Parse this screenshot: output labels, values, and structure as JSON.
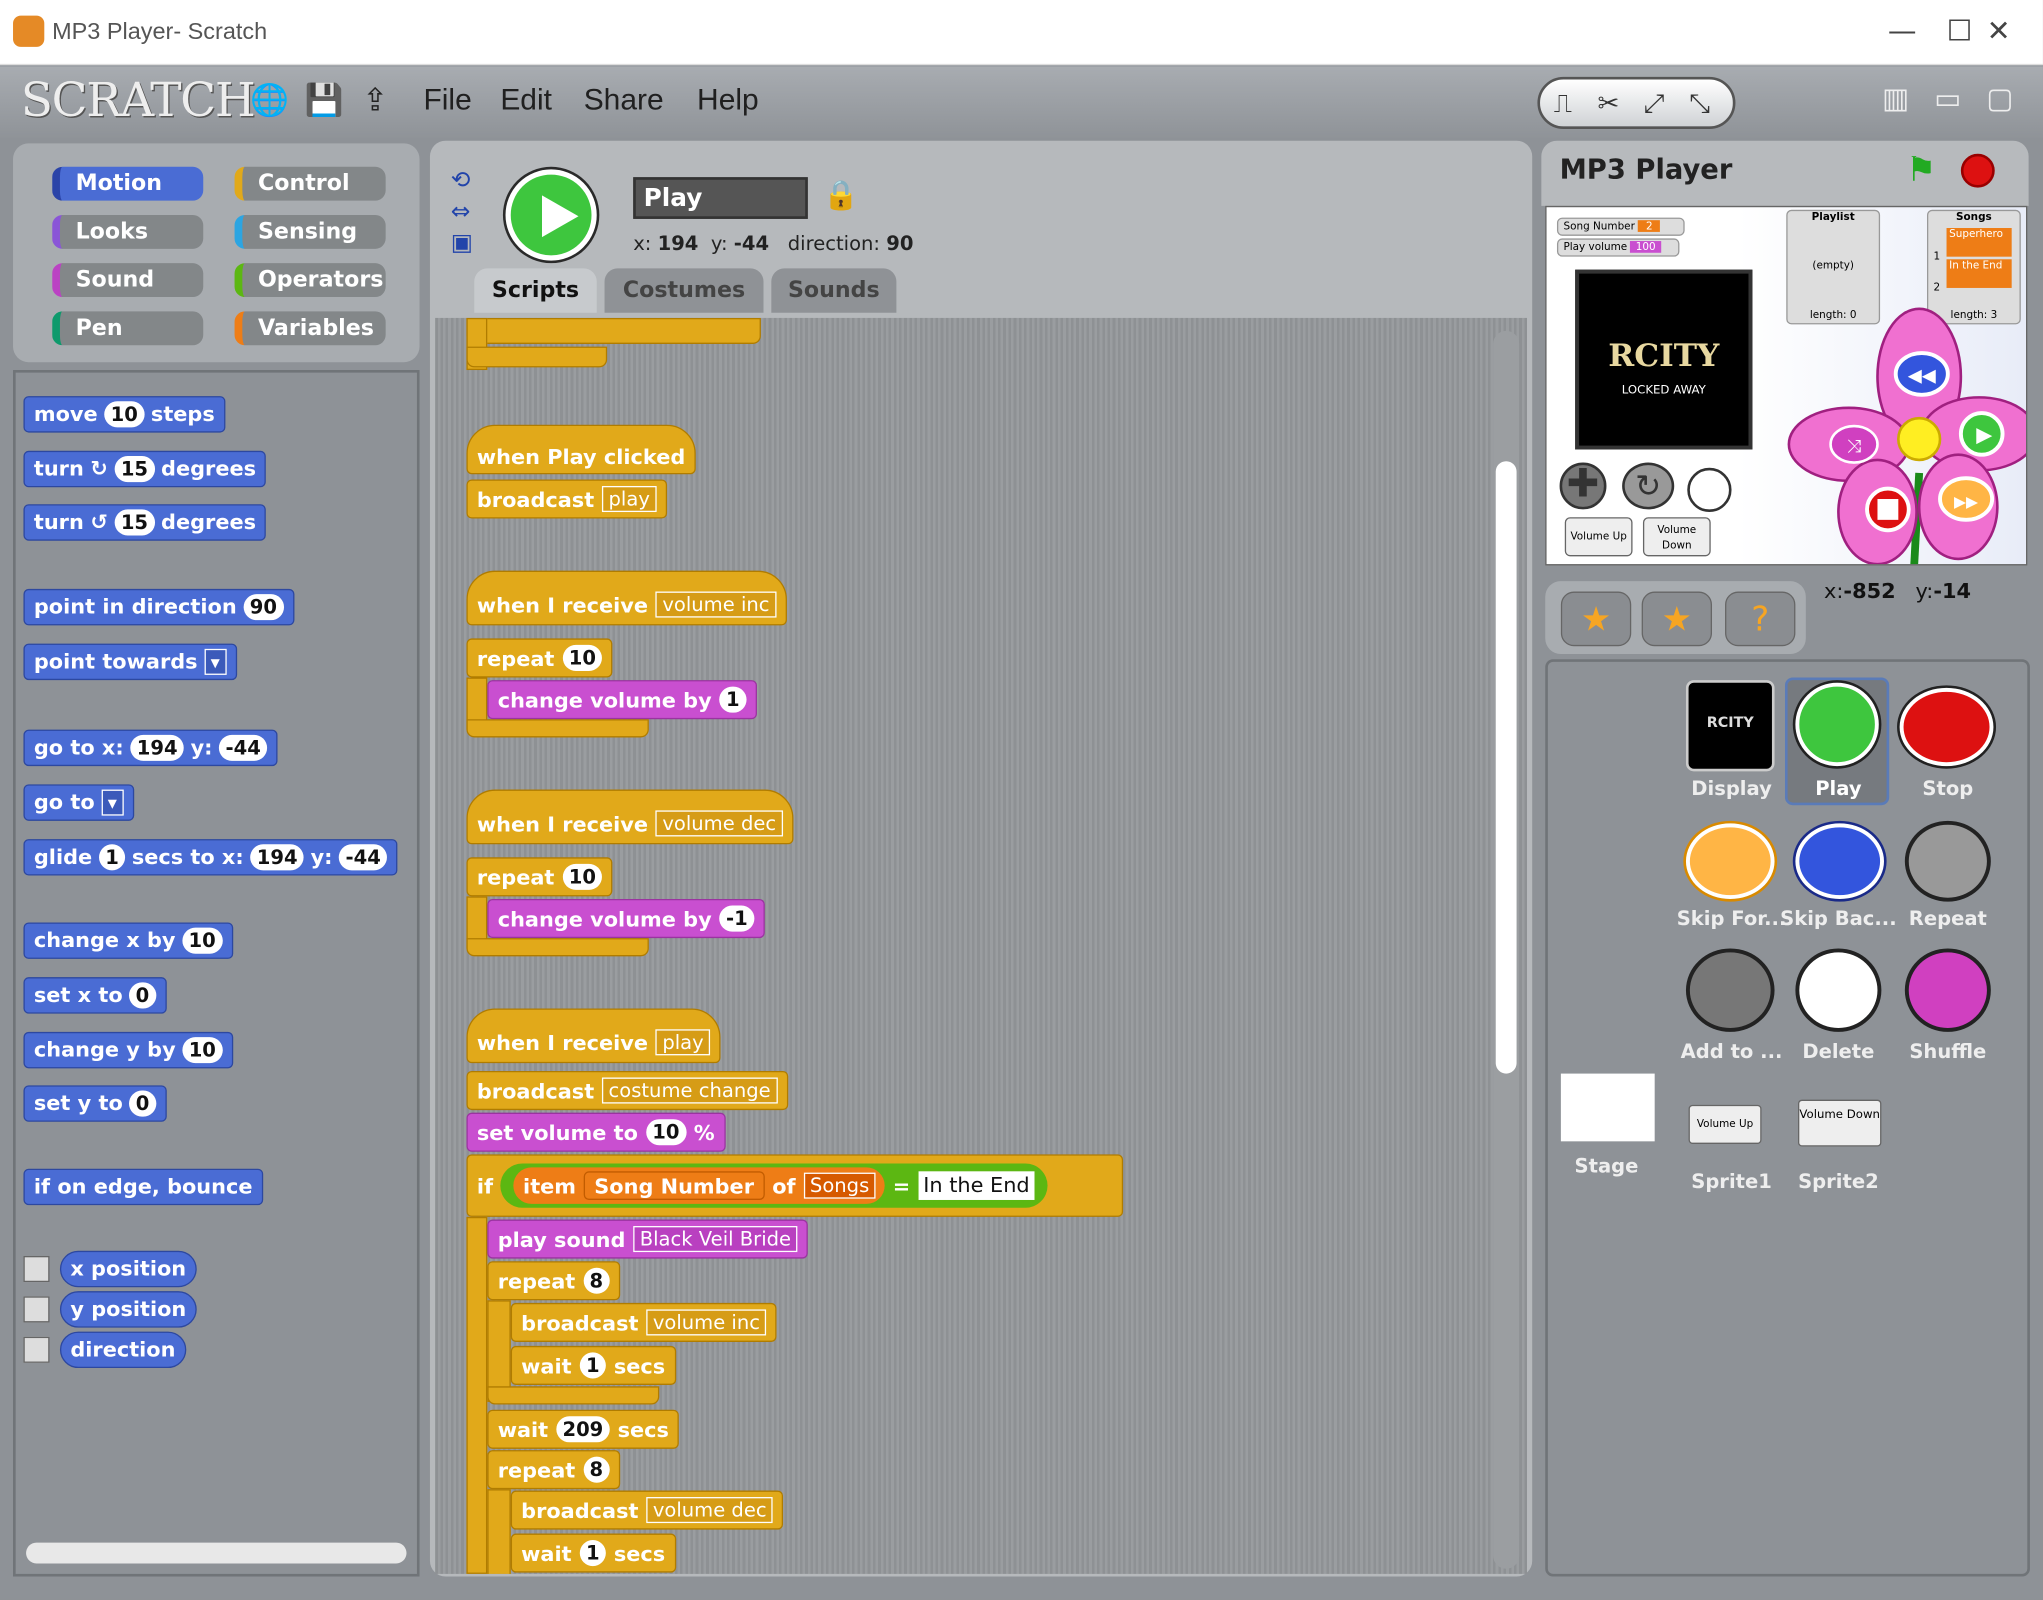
{
  "window": {
    "title": "MP3 Player- Scratch",
    "minimize_glyph": "—",
    "maximize_glyph": "☐",
    "close_glyph": "✕"
  },
  "logo": "SCRATCH",
  "menu": {
    "file": "File",
    "edit": "Edit",
    "share": "Share",
    "help": "Help"
  },
  "categories": {
    "motion": "Motion",
    "looks": "Looks",
    "sound": "Sound",
    "pen": "Pen",
    "control": "Control",
    "sensing": "Sensing",
    "operators": "Operators",
    "variables": "Variables"
  },
  "palette": {
    "move_a": "move",
    "move_n": "10",
    "move_b": "steps",
    "turn_cw_a": "turn",
    "turn_cw_n": "15",
    "turn_cw_b": "degrees",
    "turn_ccw_a": "turn",
    "turn_ccw_n": "15",
    "turn_ccw_b": "degrees",
    "point_dir_a": "point in direction",
    "point_dir_n": "90",
    "point_towards": "point towards",
    "goto_a": "go to x:",
    "goto_x": "194",
    "goto_b": "y:",
    "goto_y": "-44",
    "goto_sprite": "go to",
    "glide_a": "glide",
    "glide_n": "1",
    "glide_b": "secs to x:",
    "glide_x": "194",
    "glide_c": "y:",
    "glide_y": "-44",
    "change_x_a": "change x by",
    "change_x_n": "10",
    "set_x_a": "set x to",
    "set_x_n": "0",
    "change_y_a": "change y by",
    "change_y_n": "10",
    "set_y_a": "set y to",
    "set_y_n": "0",
    "bounce": "if on edge, bounce",
    "x_position": "x position",
    "y_position": "y position",
    "direction": "direction"
  },
  "sprite": {
    "name": "Play",
    "x_label": "x:",
    "x": "194",
    "y_label": "y:",
    "y": "-44",
    "direction_label": "direction:",
    "direction": "90"
  },
  "tabs": {
    "scripts": "Scripts",
    "costumes": "Costumes",
    "sounds": "Sounds"
  },
  "scripts": {
    "s1_hat": "when Play clicked",
    "s1_bc": "broadcast",
    "s1_msg": "play",
    "s2_hat": "when I receive",
    "s2_msg": "volume inc",
    "s2_rep": "repeat",
    "s2_n": "10",
    "s2_cv": "change volume by",
    "s2_v": "1",
    "s3_hat": "when I receive",
    "s3_msg": "volume dec",
    "s3_rep": "repeat",
    "s3_n": "10",
    "s3_cv": "change volume by",
    "s3_v": "-1",
    "s4_hat": "when I receive",
    "s4_msg": "play",
    "s4_bc": "broadcast",
    "s4_bcmsg": "costume change",
    "s4_setvol": "set volume to",
    "s4_vol": "10",
    "s4_pct": "%",
    "s4_if": "if",
    "s4_item": "item",
    "s4_var": "Song Number",
    "s4_of": "of",
    "s4_list": "Songs",
    "s4_eq": "=",
    "s4_val": "In the End",
    "s4_play": "play sound",
    "s4_sound": "Black Veil Bride",
    "s4_rep1": "repeat",
    "s4_rep1n": "8",
    "s4_bc2": "broadcast",
    "s4_bc2msg": "volume inc",
    "s4_wait1": "wait",
    "s4_wait1n": "1",
    "s4_secs1": "secs",
    "s4_wait2": "wait",
    "s4_wait2n": "209",
    "s4_secs2": "secs",
    "s4_rep2": "repeat",
    "s4_rep2n": "8",
    "s4_bc3": "broadcast",
    "s4_bc3msg": "volume dec",
    "s4_wait3": "wait",
    "s4_wait3n": "1",
    "s4_secs3": "secs"
  },
  "stage": {
    "title": "MP3 Player",
    "song_number_label": "Song Number",
    "song_number_value": "2",
    "play_volume_label": "Play volume",
    "play_volume_value": "100",
    "playlist_title": "Playlist",
    "playlist_empty": "(empty)",
    "playlist_length": "length: 0",
    "songs_title": "Songs",
    "songs_item1_idx": "1",
    "songs_item1": "Superhero",
    "songs_item2_idx": "2",
    "songs_item2": "In the End",
    "songs_length": "length: 3",
    "album_title": "RCITY",
    "album_sub": "LOCKED AWAY",
    "volume_up": "Volume Up",
    "volume_down": "Volume Down",
    "mouse_x_label": "x:",
    "mouse_x": "-852",
    "mouse_y_label": "y:",
    "mouse_y": "-14"
  },
  "sprites": [
    "Display",
    "Play",
    "Stop",
    "Skip For...",
    "Skip Bac...",
    "Repeat",
    "Add to ...",
    "Delete",
    "Shuffle",
    "Sprite1",
    "Sprite2"
  ],
  "stage_label": "Stage",
  "sprite_thumb_text": {
    "display": "RCITY",
    "volume_up": "Volume Up",
    "volume_down": "Volume Down"
  },
  "colors": {
    "motion": "#4a6cd4",
    "looks": "#8a55d7",
    "sound": "#bb42c3",
    "pen": "#0e9a6c",
    "control": "#e1a91a",
    "sensing": "#2ca5e2",
    "operators": "#5cb712",
    "variables": "#ee7d16"
  }
}
